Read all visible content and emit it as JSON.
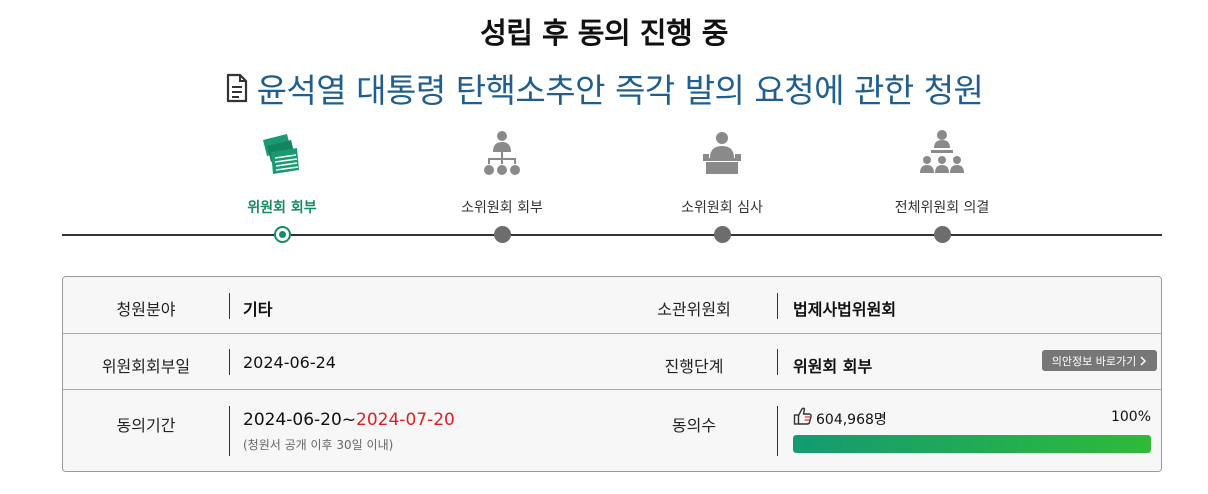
{
  "header": {
    "status": "성립 후 동의 진행 중",
    "petition_title": "윤석열 대통령 탄핵소추안 즉각 발의 요청에 관한 청원"
  },
  "steps": [
    {
      "label": "위원회 회부",
      "icon": "stacked-documents-icon",
      "active": true
    },
    {
      "label": "소위원회 회부",
      "icon": "org-chart-icon",
      "active": false
    },
    {
      "label": "소위원회 심사",
      "icon": "podium-speaker-icon",
      "active": false
    },
    {
      "label": "전체위원회 의결",
      "icon": "assembly-meeting-icon",
      "active": false
    }
  ],
  "info": {
    "field_label": "청원분야",
    "field_value": "기타",
    "committee_label": "소관위원회",
    "committee_value": "법제사법위원회",
    "referral_label": "위원회회부일",
    "referral_value": "2024-06-24",
    "stage_label": "진행단계",
    "stage_value": "위원회 회부",
    "goto_button": "의안정보 바로가기",
    "period_label": "동의기간",
    "period_start": "2024-06-20~",
    "period_end": "2024-07-20",
    "period_note": "(청원서 공개 이후 30일 이내)",
    "agree_label": "동의수",
    "agree_count": "604,968명",
    "agree_percent": "100%",
    "progress_fraction": 1.0
  },
  "colors": {
    "accent_green": "#168c62",
    "title_blue": "#1f5e8e",
    "end_date_red": "#e02020"
  }
}
